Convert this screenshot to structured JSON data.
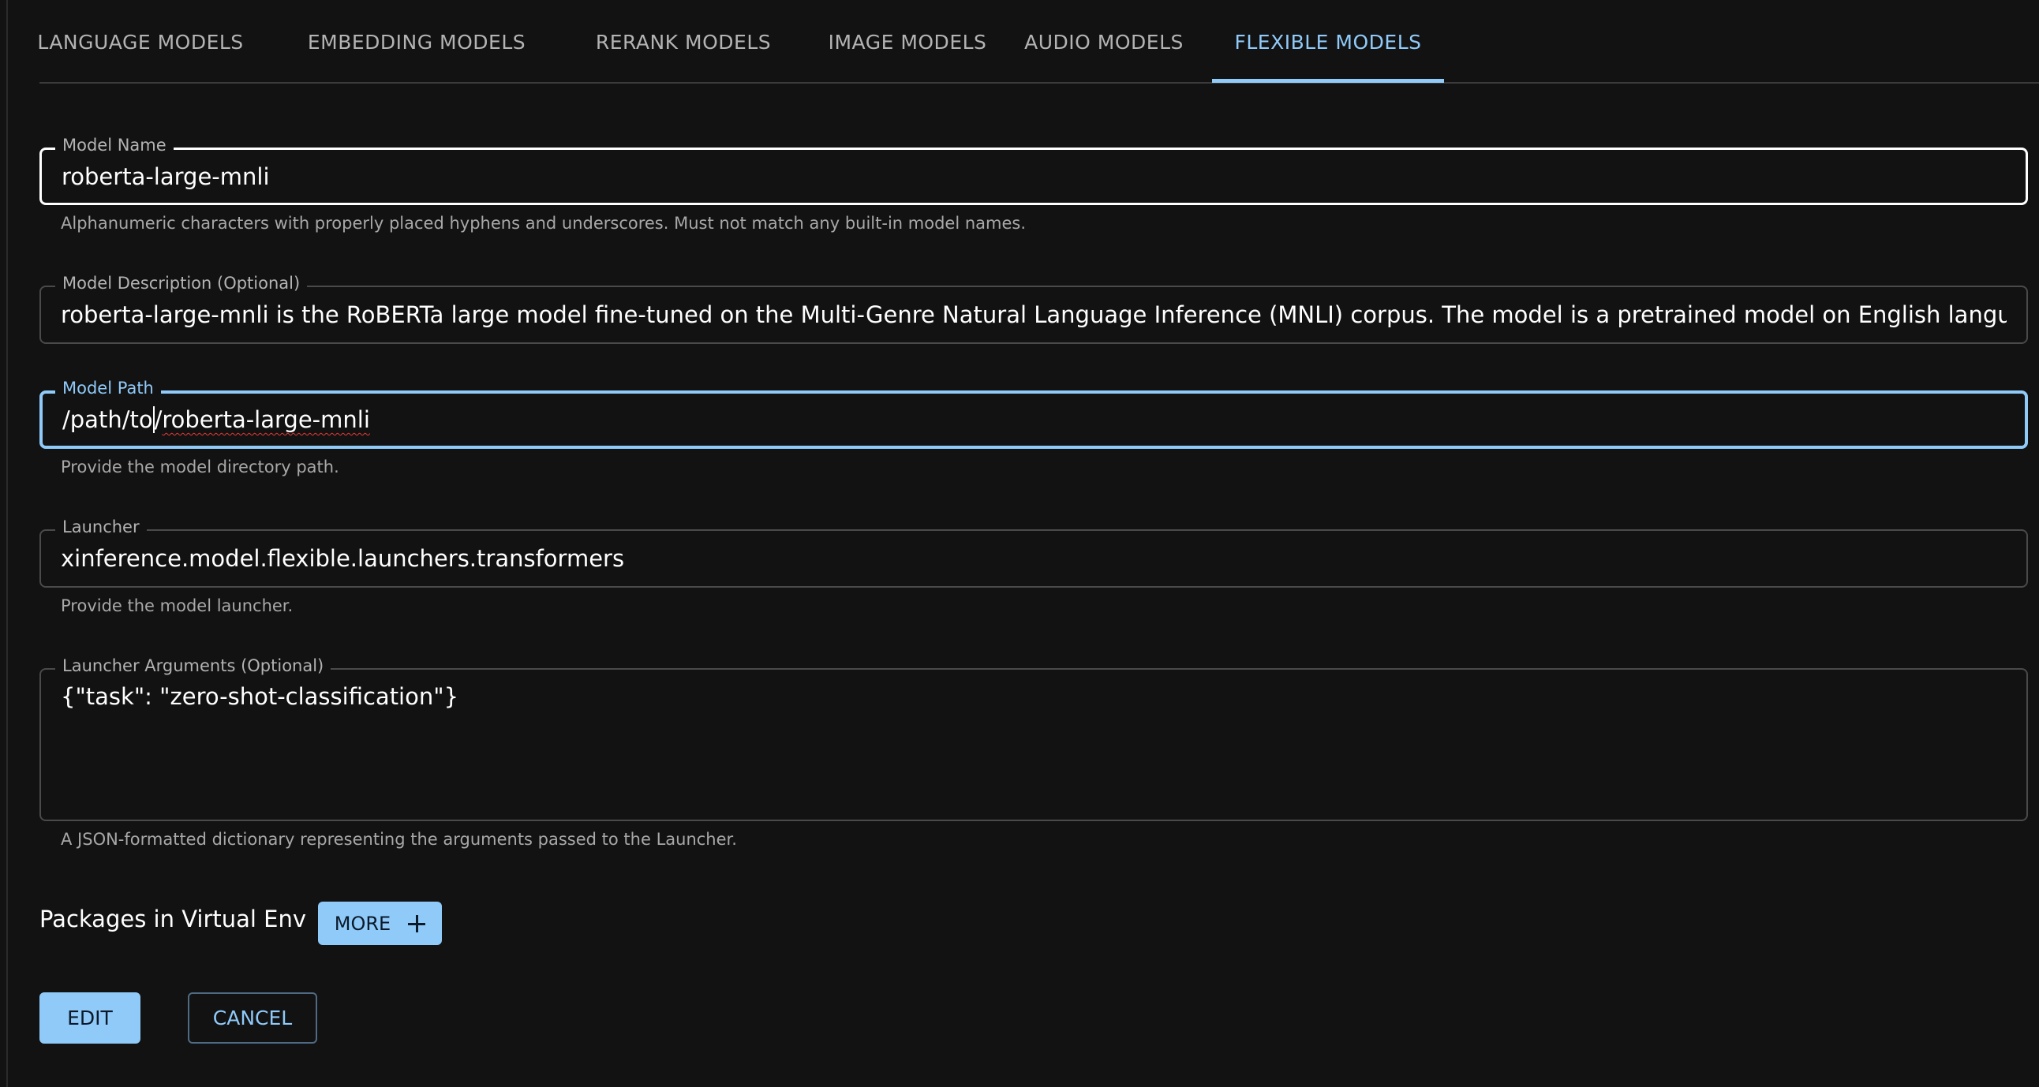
{
  "tabs": [
    {
      "label": "LANGUAGE MODELS"
    },
    {
      "label": "EMBEDDING MODELS"
    },
    {
      "label": "RERANK MODELS"
    },
    {
      "label": "IMAGE MODELS"
    },
    {
      "label": "AUDIO MODELS"
    },
    {
      "label": "FLEXIBLE MODELS",
      "active": true
    }
  ],
  "form": {
    "model_name": {
      "label": "Model Name",
      "value": "roberta-large-mnli",
      "helper": "Alphanumeric characters with properly placed hyphens and underscores. Must not match any built-in model names."
    },
    "model_description": {
      "label": "Model Description (Optional)",
      "value": "roberta-large-mnli is the RoBERTa large model fine-tuned on the Multi-Genre Natural Language Inference (MNLI) corpus. The model is a pretrained model on English language text usi"
    },
    "model_path": {
      "label": "Model Path",
      "value_before_caret": "/path/to",
      "value_after_caret_plain": "/",
      "value_after_caret_flagged": "roberta-large-mnli",
      "helper": "Provide the model directory path."
    },
    "launcher": {
      "label": "Launcher",
      "value": "xinference.model.flexible.launchers.transformers",
      "helper": "Provide the model launcher."
    },
    "launcher_args": {
      "label": "Launcher Arguments (Optional)",
      "value": "{\"task\": \"zero-shot-classification\"}",
      "helper": "A JSON-formatted dictionary representing the arguments passed to the Launcher."
    }
  },
  "packages": {
    "label": "Packages in Virtual Env",
    "more_label": "MORE"
  },
  "actions": {
    "edit_label": "EDIT",
    "cancel_label": "CANCEL"
  },
  "colors": {
    "accent": "#90caf9",
    "background": "#121212",
    "spell_error": "#e53935"
  }
}
